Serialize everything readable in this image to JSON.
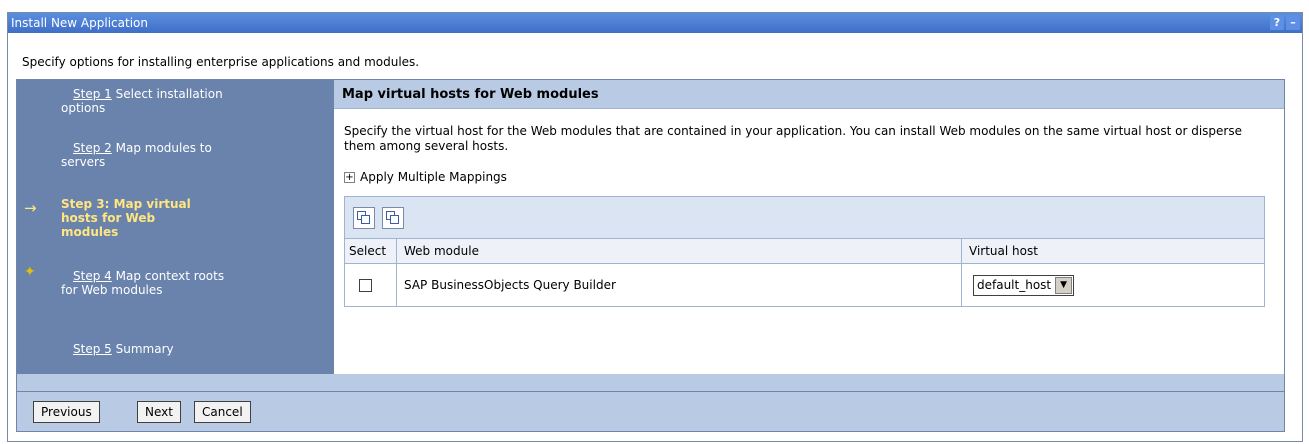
{
  "window": {
    "title": "Install New Application",
    "help_label": "?",
    "minimize_label": "–"
  },
  "intro_text": "Specify options for installing enterprise applications and modules.",
  "steps": [
    {
      "link": "Step 1",
      "text": "Select installation options"
    },
    {
      "link": "Step 2",
      "text": "Map modules to servers"
    },
    {
      "link": "",
      "text": "Step 3: Map virtual hosts for Web modules"
    },
    {
      "link": "Step 4",
      "text": "Map context roots for Web modules"
    },
    {
      "link": "Step 5",
      "text": "Summary"
    }
  ],
  "markers": {
    "current_arrow": "→",
    "next_star": "✦"
  },
  "main": {
    "heading": "Map virtual hosts for Web modules",
    "description": "Specify the virtual host for the Web modules that are contained in your application. You can install Web modules on the same virtual host or disperse them among several hosts.",
    "apply_multiple": "Apply Multiple Mappings",
    "expand_symbol": "+"
  },
  "table": {
    "columns": [
      "Select",
      "Web module",
      "Virtual host"
    ],
    "rows": [
      {
        "selected": false,
        "web_module": "SAP BusinessObjects Query Builder",
        "virtual_host": "default_host"
      }
    ]
  },
  "buttons": {
    "previous": "Previous",
    "next": "Next",
    "cancel": "Cancel"
  },
  "colors": {
    "titlebar": "#4a7bd0",
    "steps_panel": "#6983ad",
    "current_step": "#ffe680",
    "header_bg": "#b9cbe4"
  }
}
